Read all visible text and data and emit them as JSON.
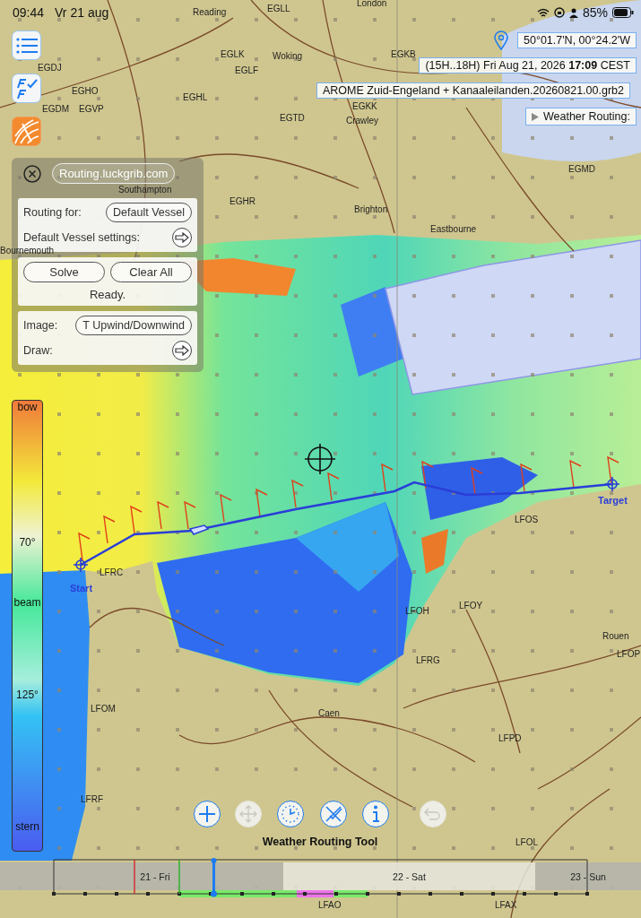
{
  "status_bar": {
    "time": "09:44",
    "date": "Vr 21 aug",
    "battery": "85%"
  },
  "map": {
    "places": [
      "Reading",
      "EGLL",
      "London",
      "EGLK",
      "Woking",
      "EGKB",
      "EGDJ",
      "EGLF",
      "EGHO",
      "EGHL",
      "EGDM",
      "EGVP",
      "EGKK",
      "EGTD",
      "Crawley",
      "EGMD",
      "Southampton",
      "EGHR",
      "Brighton",
      "Eastbourne",
      "Bournemouth",
      "LFOS",
      "LFRC",
      "LFOH",
      "LFOY",
      "Rouen",
      "LFRG",
      "LFOP",
      "LFOM",
      "Caen",
      "LFPD",
      "LFRF",
      "LFOL",
      "LFAO",
      "LFAX"
    ],
    "route_markers": [
      "Start",
      "Target"
    ]
  },
  "info_boxes": {
    "position": "50°01.7'N, 00°24.2'W",
    "time_window": "(15H..18H) Fri Aug 21, 2026 **17:09** CEST",
    "grib_file": "AROME Zuid-Engeland + Kanaaleilanden.20260821.00.grb2",
    "weather_routing": {
      "label": "Weather Routing:",
      "expanded": false
    }
  },
  "routing_panel": {
    "title": "Routing.luckgrib.com",
    "routing_for_label": "Routing for:",
    "vessel": "Default Vessel",
    "settings_label": "Default Vessel settings:",
    "solve": "Solve",
    "clear_all": "Clear All",
    "status": "Ready.",
    "image_label": "Image:",
    "image_value": "T Upwind/Downwind",
    "draw_label": "Draw:"
  },
  "legend": [
    "bow",
    "70°",
    "beam",
    "125°",
    "stern"
  ],
  "toolbar": {
    "title": "Weather Routing Tool",
    "buttons": [
      {
        "kind": "add",
        "disabled": false
      },
      {
        "kind": "move",
        "disabled": true
      },
      {
        "kind": "clock",
        "disabled": false
      },
      {
        "kind": "cancel",
        "disabled": false
      },
      {
        "kind": "info",
        "disabled": false
      },
      {
        "kind": "undo",
        "disabled": true
      }
    ]
  },
  "timeline": {
    "days": [
      {
        "label": "21 - Fri",
        "shaded": true
      },
      {
        "label": "22 - Sat",
        "shaded": false
      },
      {
        "label": "23 - Sun",
        "shaded": true
      }
    ],
    "cursor": {
      "level": 0.3
    }
  }
}
